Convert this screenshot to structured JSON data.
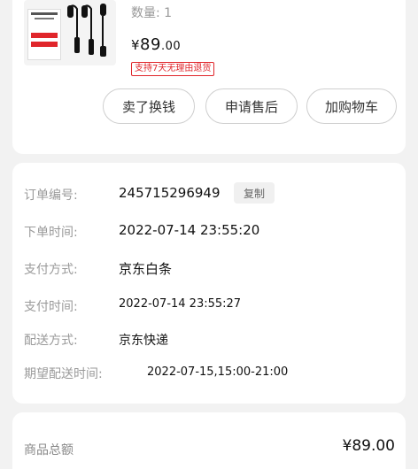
{
  "product": {
    "quantity_label": "数量: 1",
    "price_currency": "¥",
    "price_integer": "89",
    "price_decimal": ".00",
    "return_badge": "支持7天无理由退货",
    "buttons": {
      "sell": "卖了换钱",
      "after_sales": "申请售后",
      "add_to_cart": "加购物车"
    }
  },
  "order": {
    "order_no_label": "订单编号:",
    "order_no_value": "245715296949",
    "copy_label": "复制",
    "order_time_label": "下单时间:",
    "order_time_value": "2022-07-14 23:55:20",
    "pay_method_label": "支付方式:",
    "pay_method_value": "京东白条",
    "pay_time_label": "支付时间:",
    "pay_time_value": "2022-07-14 23:55:27",
    "delivery_label": "配送方式:",
    "delivery_value": "京东快递",
    "expected_label": "期望配送时间:",
    "expected_value": "2022-07-15,15:00-21:00"
  },
  "summary": {
    "total_label": "商品总额",
    "total_value": "¥89.00"
  },
  "colors": {
    "accent_red": "#e0262b",
    "background": "#f2f2f2"
  }
}
